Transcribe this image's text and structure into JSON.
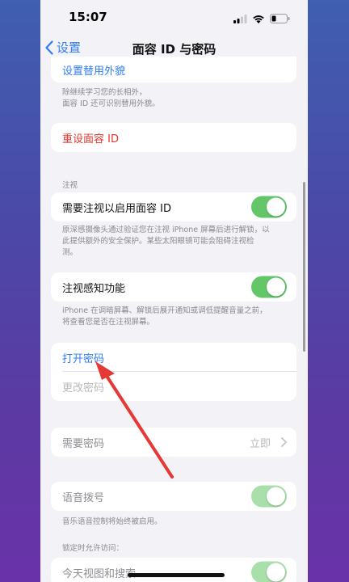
{
  "status_bar": {
    "time": "15:07"
  },
  "nav": {
    "back_label": "设置",
    "title": "面容 ID 与密码"
  },
  "alt_appearance": {
    "label": "设置替用外貌",
    "footnote_line1": "除继续学习您的长相外，",
    "footnote_line2": "面容 ID 还可识别替用外貌。"
  },
  "reset": {
    "label": "重设面容 ID"
  },
  "attention": {
    "section_label": "注视",
    "require_label": "需要注视以启用面容 ID",
    "require_on": true,
    "require_footnote_line1": "原深感摄像头通过验证您在注视 iPhone 屏幕后进行解锁，以",
    "require_footnote_line2": "此提供额外的安全保护。某些太阳眼镜可能会阻碍注视检",
    "require_footnote_line3": "测。",
    "aware_label": "注视感知功能",
    "aware_on": true,
    "aware_footnote_line1": "iPhone 在调暗屏幕、解锁后展开通知或调低提醒音量之前，",
    "aware_footnote_line2": "将查看您是否在注视屏幕。"
  },
  "passcode": {
    "turn_on": "打开密码",
    "change": "更改密码"
  },
  "require_passcode": {
    "label": "需要密码",
    "value": "立即"
  },
  "voice_dial": {
    "label": "语音拨号",
    "on": true,
    "footnote": "音乐语音控制将始终被启用。"
  },
  "locked_access": {
    "section_label": "锁定时允许访问：",
    "today_view": "今天视图和搜索"
  },
  "colors": {
    "accent": "#2f7df6",
    "toggle_on": "#63c76a",
    "destructive": "#e5342f",
    "annotation_arrow": "#e53935"
  }
}
